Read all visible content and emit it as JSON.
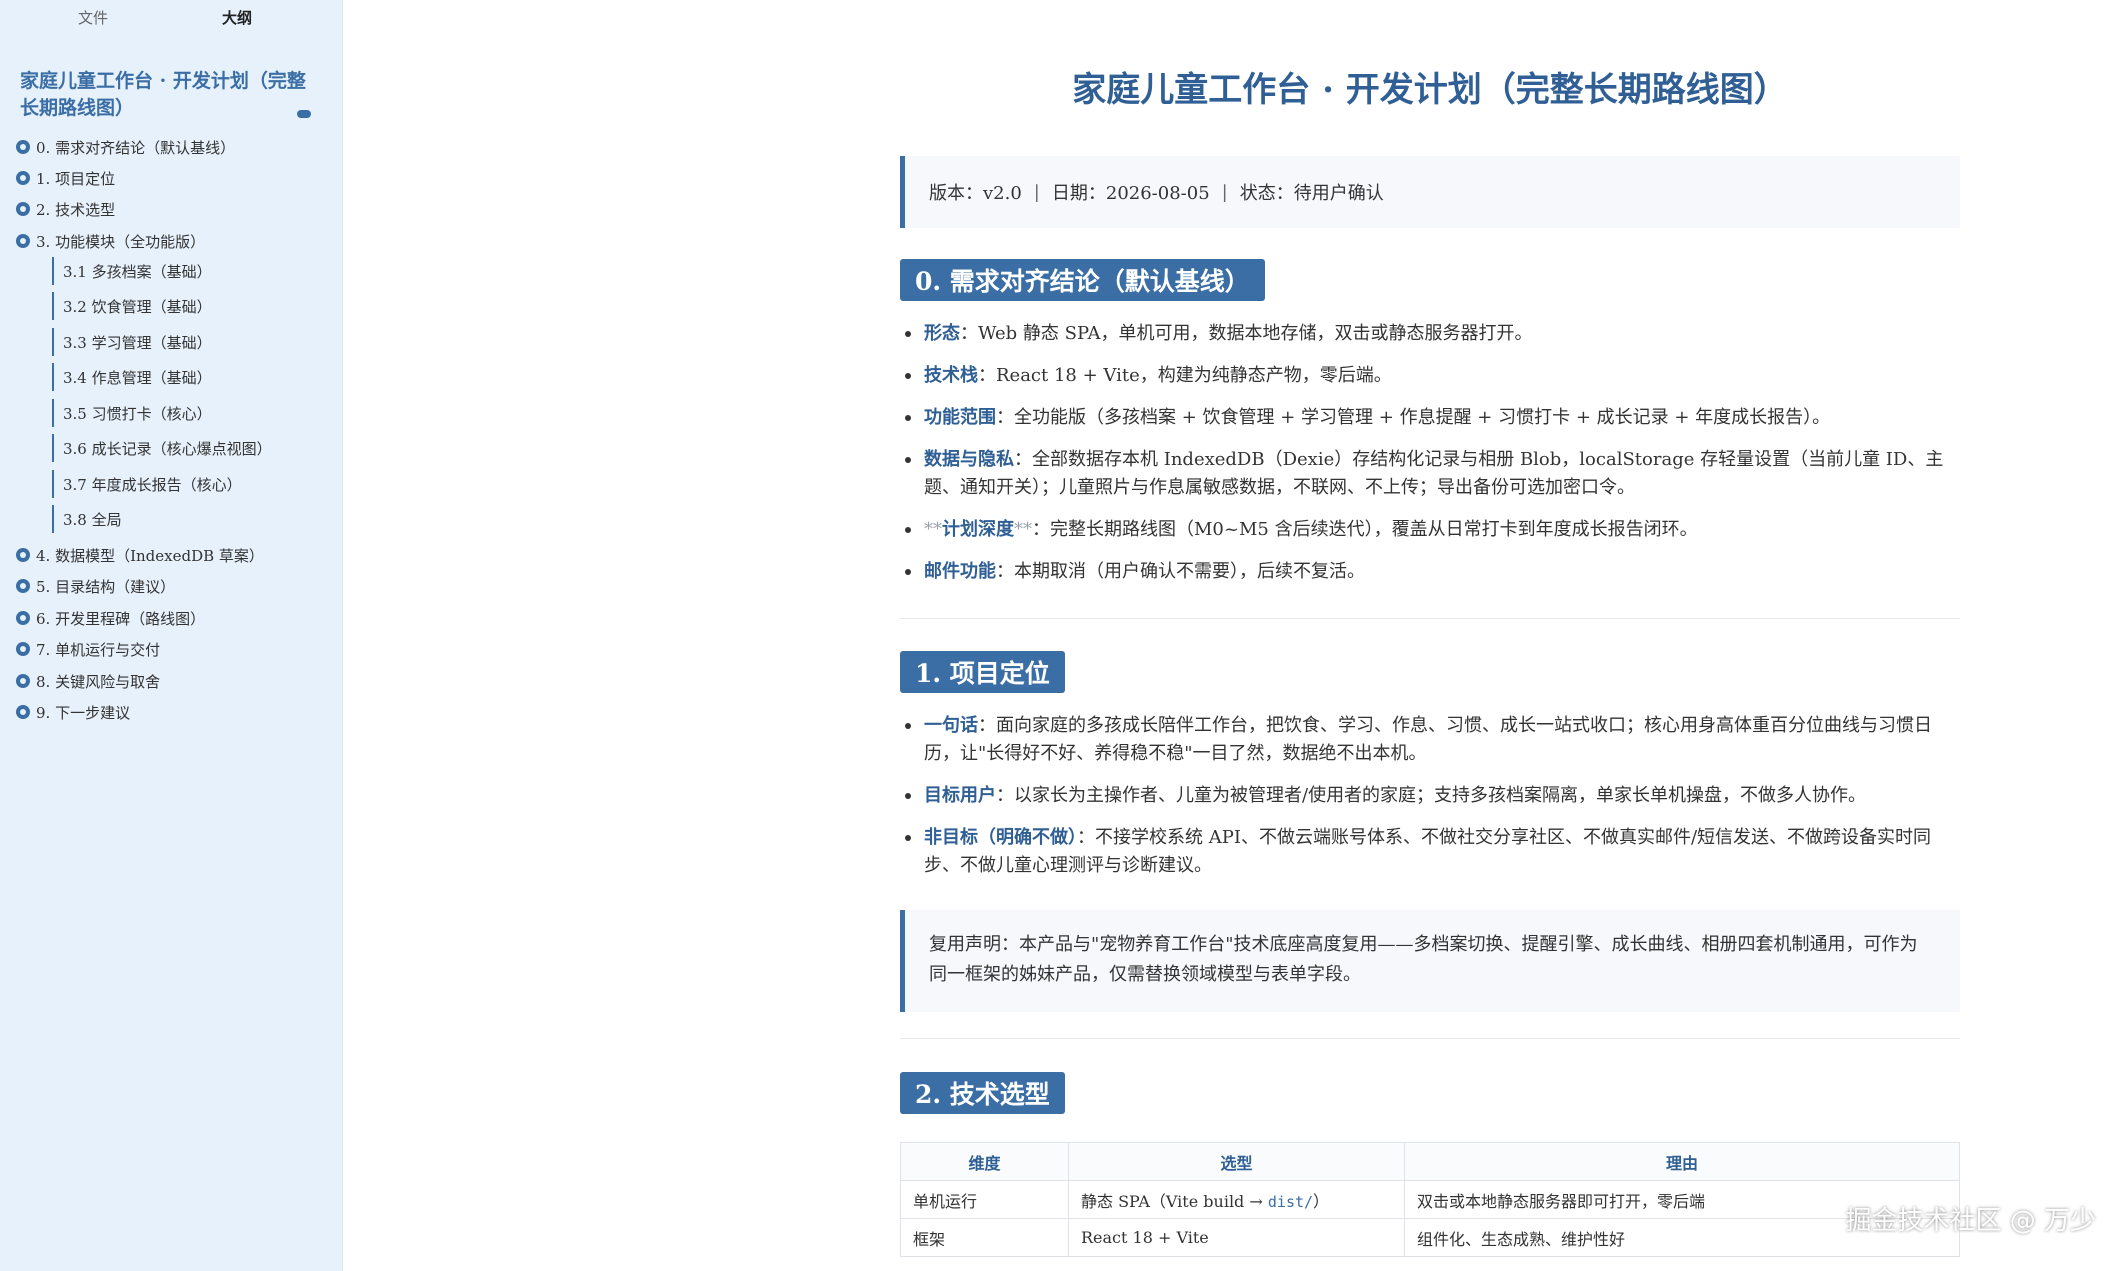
{
  "sidebar": {
    "tabs": [
      "文件",
      "大纲"
    ],
    "doc_title": "家庭儿童工作台 · 开发计划（完整长期路线图）",
    "outline": [
      "0. 需求对齐结论（默认基线）",
      "1. 项目定位",
      "2. 技术选型",
      "3. 功能模块（全功能版）",
      "4. 数据模型（IndexedDB 草案）",
      "5. 目录结构（建议）",
      "6. 开发里程碑（路线图）",
      "7. 单机运行与交付",
      "8. 关键风险与取舍",
      "9. 下一步建议"
    ],
    "sub_outline": [
      "3.1 多孩档案（基础）",
      "3.2 饮食管理（基础）",
      "3.3 学习管理（基础）",
      "3.4 作息管理（基础）",
      "3.5 习惯打卡（核心）",
      "3.6 成长记录（核心爆点视图）",
      "3.7 年度成长报告（核心）",
      "3.8 全局"
    ]
  },
  "doc": {
    "title": "家庭儿童工作台 · 开发计划（完整长期路线图）",
    "meta": {
      "version": "版本：v2.0",
      "date": "日期：2026-08-05",
      "status": "状态：待用户确认",
      "sep": "|"
    },
    "section0": {
      "heading": "0. 需求对齐结论（默认基线）",
      "items": [
        {
          "key": "形态",
          "text": "：Web 静态 SPA，单机可用，数据本地存储，双击或静态服务器打开。"
        },
        {
          "key": "技术栈",
          "text": "：React 18 + Vite，构建为纯静态产物，零后端。"
        },
        {
          "key": "功能范围",
          "text": "：全功能版（多孩档案 + 饮食管理 + 学习管理 + 作息提醒 + 习惯打卡 + 成长记录 + 年度成长报告）。"
        },
        {
          "key": "数据与隐私",
          "text": "：全部数据存本机 IndexedDB（Dexie）存结构化记录与相册 Blob，localStorage 存轻量设置（当前儿童 ID、主题、通知开关）；儿童照片与作息属敏感数据，不联网、不上传；导出备份可选加密口令。"
        },
        {
          "key_prefix": "**",
          "key": "计划深度",
          "key_suffix": "**",
          "text": "：完整长期路线图（M0~M5 含后续迭代），覆盖从日常打卡到年度成长报告闭环。"
        },
        {
          "key": "邮件功能",
          "text": "：本期取消（用户确认不需要），后续不复活。"
        }
      ]
    },
    "section1": {
      "heading": "1. 项目定位",
      "items": [
        {
          "key": "一句话",
          "text": "：面向家庭的多孩成长陪伴工作台，把饮食、学习、作息、习惯、成长一站式收口；核心用身高体重百分位曲线与习惯日历，让\"长得好不好、养得稳不稳\"一目了然，数据绝不出本机。"
        },
        {
          "key": "目标用户",
          "text": "：以家长为主操作者、儿童为被管理者/使用者的家庭；支持多孩档案隔离，单家长单机操盘，不做多人协作。"
        },
        {
          "key": "非目标（明确不做）",
          "text": "：不接学校系统 API、不做云端账号体系、不做社交分享社区、不做真实邮件/短信发送、不做跨设备实时同步、不做儿童心理测评与诊断建议。"
        }
      ],
      "quote": "复用声明：本产品与\"宠物养育工作台\"技术底座高度复用——多档案切换、提醒引擎、成长曲线、相册四套机制通用，可作为同一框架的姊妹产品，仅需替换领域模型与表单字段。"
    },
    "section2": {
      "heading": "2. 技术选型",
      "table": {
        "headers": [
          "维度",
          "选型",
          "理由"
        ],
        "rows": [
          {
            "dim": "单机运行",
            "choice_prefix": "静态 SPA（Vite build → ",
            "choice_code": "dist/",
            "choice_suffix": "）",
            "reason": "双击或本地静态服务器即可打开，零后端"
          },
          {
            "dim": "框架",
            "choice_prefix": "React 18 + Vite",
            "choice_code": "",
            "choice_suffix": "",
            "reason": "组件化、生态成熟、维护性好"
          }
        ]
      }
    }
  },
  "watermark": "掘金技术社区 @ 万少",
  "colors": {
    "accent": "#3a6ea5",
    "sidebar_bg": "#e6f1fb",
    "title": "#2f5f94"
  }
}
